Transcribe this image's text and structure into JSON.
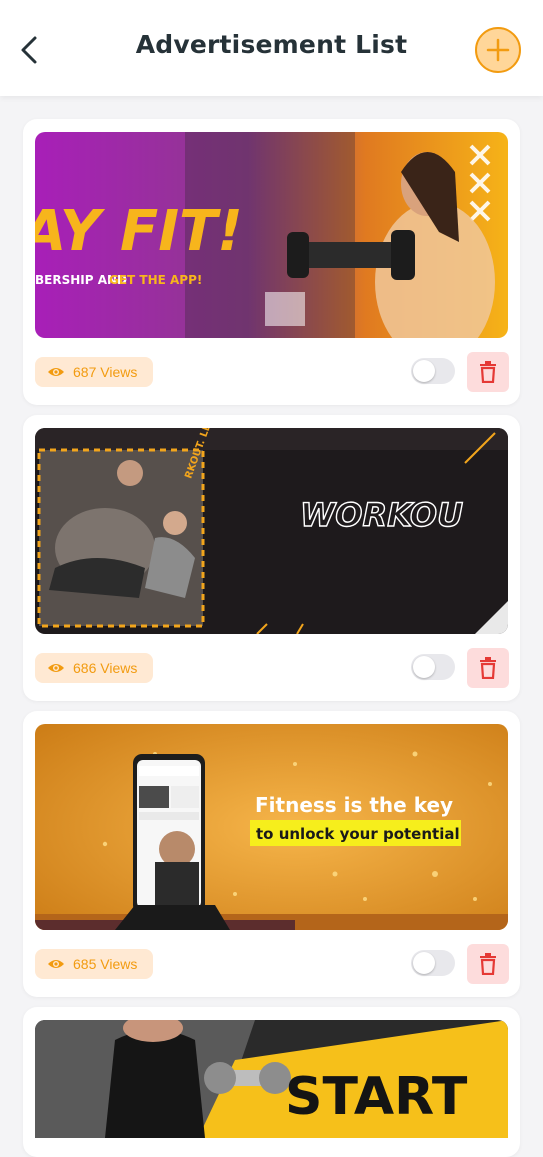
{
  "header": {
    "title": "Advertisement List"
  },
  "ads": [
    {
      "views_label": "687 Views",
      "banner": {
        "headline": "AY FIT!",
        "subline_a": "BERSHIP AND ",
        "subline_b": "GET THE APP!"
      }
    },
    {
      "views_label": "686 Views",
      "banner": {
        "headline": "WORKOU",
        "ring_text": "RKOUT. LET'S W"
      }
    },
    {
      "views_label": "685 Views",
      "banner": {
        "line1": "Fitness is the key",
        "line2": "to unlock your potential"
      }
    },
    {
      "banner": {
        "headline": "START"
      }
    }
  ],
  "colors": {
    "accent": "#f29b10",
    "delete_bg": "#fddcdc",
    "delete_icon": "#e53935",
    "views_bg": "#ffe9d3"
  },
  "icons": [
    "back-arrow-icon",
    "plus-icon",
    "eye-icon",
    "trash-icon"
  ]
}
